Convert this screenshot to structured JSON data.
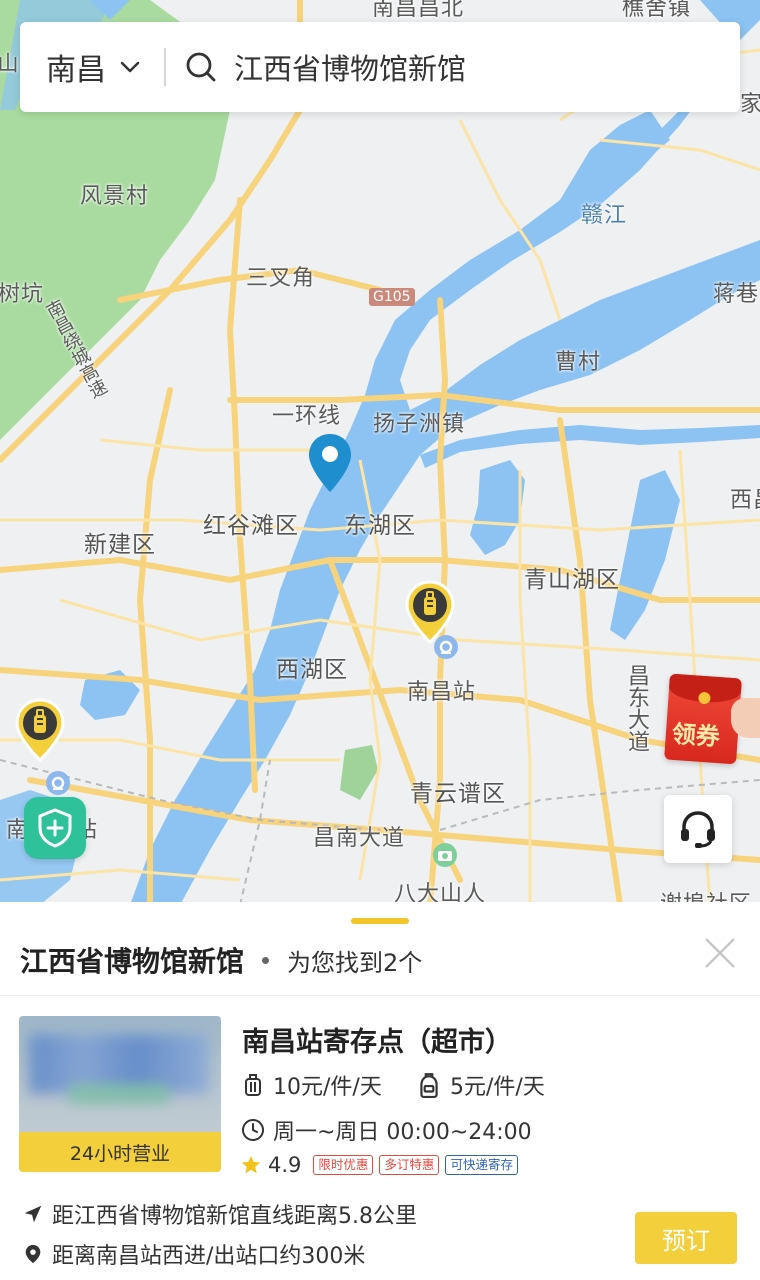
{
  "search": {
    "city": "南昌",
    "query": "江西省博物馆新馆"
  },
  "map": {
    "labels": {
      "nanchang_changbei": "南昌昌北",
      "zhuqiao_town": "樵舍镇",
      "fengjing_village": "风景村",
      "ganjiang": "赣江",
      "sanchajiao": "三叉角",
      "g105": "G105",
      "shuikeng": "树坑",
      "jiangxiang": "蒋巷",
      "caocun": "曹村",
      "nanchang_raocheng": "南昌绕城高速",
      "yihuanxian": "一环线",
      "yangzizhou": "扬子洲镇",
      "honggutan": "红谷滩区",
      "donghu": "东湖区",
      "xinjian": "新建区",
      "qingshanhu": "青山湖区",
      "xihu": "西湖区",
      "nanchang_station": "南昌站",
      "changdong_avenue": "昌东大道",
      "qingyunpu": "青云谱区",
      "changnan_avenue": "昌南大道",
      "nan_west_station": "南昌西站",
      "badashanren": "八大山人",
      "xietang": "谢埠社区",
      "xi": "西昌",
      "jia": "家",
      "shan": "山"
    },
    "colors": {
      "land": "#eef0f2",
      "water": "#8cc3f2",
      "green": "#a9dba0",
      "road_major": "#f7d37c",
      "road_minor": "#fbe4a6"
    }
  },
  "buttons": {
    "coupon": "领券"
  },
  "sheet": {
    "title": "江西省博物馆新馆",
    "count_text": "为您找到2个"
  },
  "result": {
    "name": "南昌站寄存点（超市）",
    "hours_badge": "24小时营业",
    "price_luggage": "10元/件/天",
    "price_bag": "5元/件/天",
    "hours": "周一~周日 00:00~24:00",
    "rating": "4.9",
    "tags": [
      "限时优惠",
      "多订特惠",
      "可快递寄存"
    ],
    "distance": "距江西省博物馆新馆直线距离5.8公里",
    "exit_info": "距离南昌站西进/出站口约300米",
    "book_label": "预订"
  }
}
